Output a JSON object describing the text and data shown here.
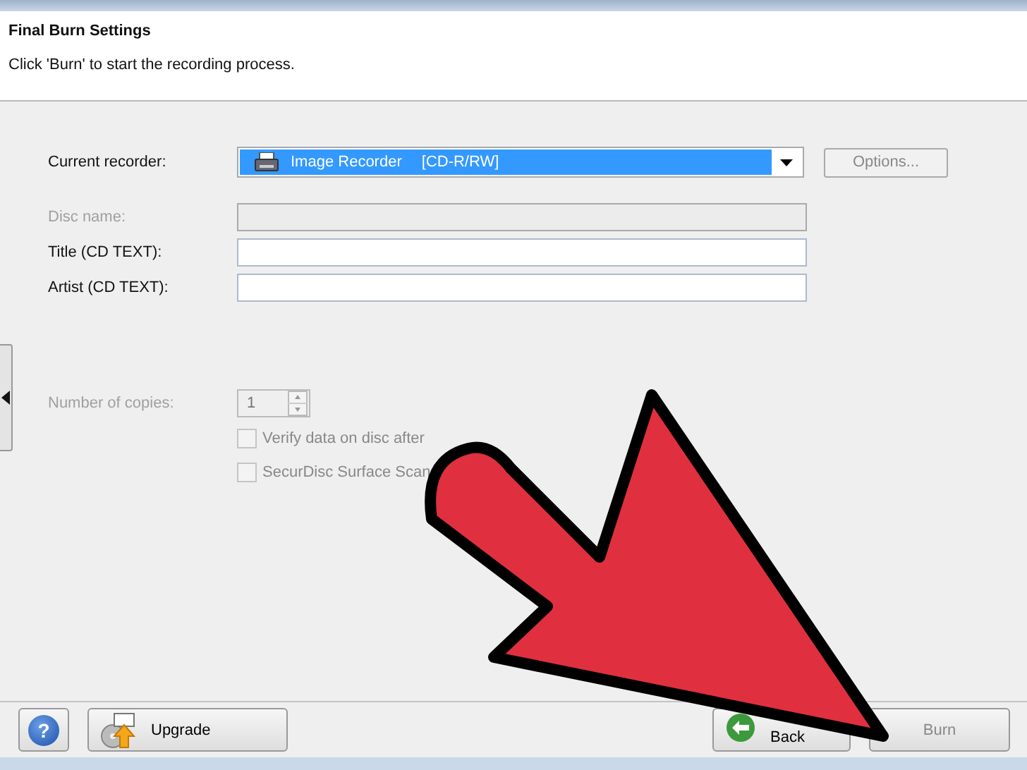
{
  "header": {
    "title": "Final Burn Settings",
    "subtitle": "Click 'Burn' to start the recording process."
  },
  "recorder": {
    "label": "Current recorder:",
    "device": "Image Recorder",
    "media": "[CD-R/RW]",
    "options_button": "Options...",
    "options_disabled": true
  },
  "fields": [
    {
      "label": "Disc name:",
      "disabled": true
    },
    {
      "label": "Title (CD TEXT):",
      "disabled": false
    },
    {
      "label": "Artist (CD TEXT):",
      "disabled": false
    }
  ],
  "copies": {
    "label": "Number of copies:",
    "value": "1",
    "disabled": true
  },
  "checkboxes": [
    {
      "label": "Verify data on disc after",
      "checked": false
    },
    {
      "label": "SecurDisc Surface Scan",
      "checked": false
    }
  ],
  "footer": {
    "help": "?",
    "upgrade": "Upgrade",
    "back": "Back",
    "burn": "Burn"
  }
}
